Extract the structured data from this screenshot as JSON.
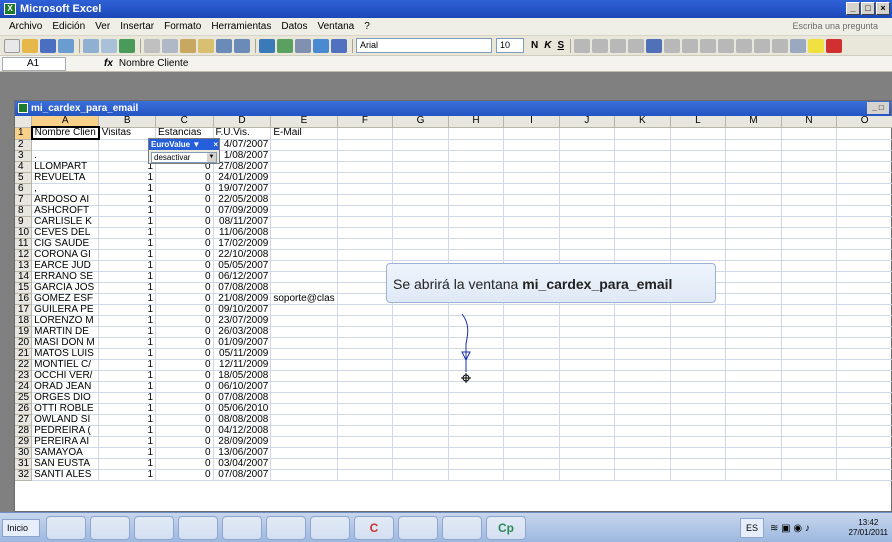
{
  "app": {
    "title": "Microsoft Excel"
  },
  "menu": {
    "items": [
      "Archivo",
      "Edición",
      "Ver",
      "Insertar",
      "Formato",
      "Herramientas",
      "Datos",
      "Ventana",
      "?"
    ],
    "ask_placeholder": "Escriba una pregunta"
  },
  "toolbar": {
    "font": "Arial",
    "size": "10",
    "bold": "N",
    "italic": "K",
    "underline": "S"
  },
  "formula": {
    "cell": "A1",
    "fx": "fx",
    "content": "Nombre Cliente"
  },
  "workbook": {
    "title": "mi_cardex_para_email"
  },
  "grid": {
    "columns": [
      "A",
      "B",
      "C",
      "D",
      "E",
      "F",
      "G",
      "H",
      "I",
      "J",
      "K",
      "L",
      "M",
      "N",
      "O"
    ],
    "rows": [
      [
        "1",
        "Nombre Clien",
        "Visitas",
        "Estancias",
        "F.U.Vis.",
        "E-Mail"
      ],
      [
        "2",
        "",
        "1",
        "",
        "4/07/2007",
        ""
      ],
      [
        "3",
        ".",
        "1",
        "",
        "1/08/2007",
        ""
      ],
      [
        "4",
        "LLOMPART",
        "1",
        "0",
        "27/08/2007",
        ""
      ],
      [
        "5",
        "REVUELTA",
        "1",
        "0",
        "24/01/2009",
        ""
      ],
      [
        "6",
        ",",
        "1",
        "0",
        "19/07/2007",
        ""
      ],
      [
        "7",
        "ARDOSO AI",
        "1",
        "0",
        "22/05/2008",
        ""
      ],
      [
        "8",
        "ASHCROFT",
        "1",
        "0",
        "07/09/2009",
        ""
      ],
      [
        "9",
        "CARLISLE K",
        "1",
        "0",
        "08/11/2007",
        ""
      ],
      [
        "10",
        "CEVES DEL",
        "1",
        "0",
        "11/06/2008",
        ""
      ],
      [
        "11",
        "CIG SAUDE",
        "1",
        "0",
        "17/02/2009",
        ""
      ],
      [
        "12",
        "CORONA GI",
        "1",
        "0",
        "22/10/2008",
        ""
      ],
      [
        "13",
        "EARCE JUD",
        "1",
        "0",
        "05/05/2007",
        ""
      ],
      [
        "14",
        "ERRANO SE",
        "1",
        "0",
        "06/12/2007",
        ""
      ],
      [
        "15",
        "GARCIA JOS",
        "1",
        "0",
        "07/08/2008",
        ""
      ],
      [
        "16",
        "GOMEZ ESF",
        "1",
        "0",
        "21/08/2009",
        "soporte@clas"
      ],
      [
        "17",
        "GUILERA PE",
        "1",
        "0",
        "09/10/2007",
        ""
      ],
      [
        "18",
        "LORENZO M",
        "1",
        "0",
        "23/07/2009",
        ""
      ],
      [
        "19",
        "MARTIN DE",
        "1",
        "0",
        "26/03/2008",
        ""
      ],
      [
        "20",
        "MASI DON M",
        "1",
        "0",
        "01/09/2007",
        ""
      ],
      [
        "21",
        "MATOS LUIS",
        "1",
        "0",
        "05/11/2009",
        ""
      ],
      [
        "22",
        "MONTIEL C/",
        "1",
        "0",
        "12/11/2009",
        ""
      ],
      [
        "23",
        "OCCHI VER/",
        "1",
        "0",
        "18/05/2008",
        ""
      ],
      [
        "24",
        "ORAD JEAN",
        "1",
        "0",
        "06/10/2007",
        ""
      ],
      [
        "25",
        "ORGES DIO",
        "1",
        "0",
        "07/08/2008",
        ""
      ],
      [
        "26",
        "OTTI ROBLE",
        "1",
        "0",
        "05/06/2010",
        ""
      ],
      [
        "27",
        "OWLAND SI",
        "1",
        "0",
        "08/08/2008",
        ""
      ],
      [
        "28",
        "PEDREIRA (",
        "1",
        "0",
        "04/12/2008",
        ""
      ],
      [
        "29",
        "PEREIRA AI",
        "1",
        "0",
        "28/09/2009",
        ""
      ],
      [
        "30",
        "SAMAYOA",
        "1",
        "0",
        "13/06/2007",
        ""
      ],
      [
        "31",
        "SAN EUSTA",
        "1",
        "0",
        "03/04/2007",
        ""
      ],
      [
        "32",
        "SANTI ALES",
        "1",
        "0",
        "07/08/2007",
        ""
      ]
    ]
  },
  "autofilter": {
    "title": "EuroValue",
    "value": "desactivar"
  },
  "callout": {
    "prefix": "Se abrirá la ventana ",
    "bold": "mi_cardex_para_email"
  },
  "taskbar": {
    "start": "Inicio",
    "apps": [
      "chrome-icon",
      "paint-icon",
      "browser-icon",
      "save-icon",
      "excel-icon",
      "word-icon",
      "app-icon",
      "c-icon",
      "folder-icon",
      "tool-icon",
      "cp-icon"
    ],
    "app_labels": [
      "",
      "",
      "",
      "",
      "",
      "",
      "",
      "C",
      "",
      "",
      "Cp"
    ],
    "lang": "ES",
    "time": "13:42",
    "date": "27/01/2011"
  }
}
